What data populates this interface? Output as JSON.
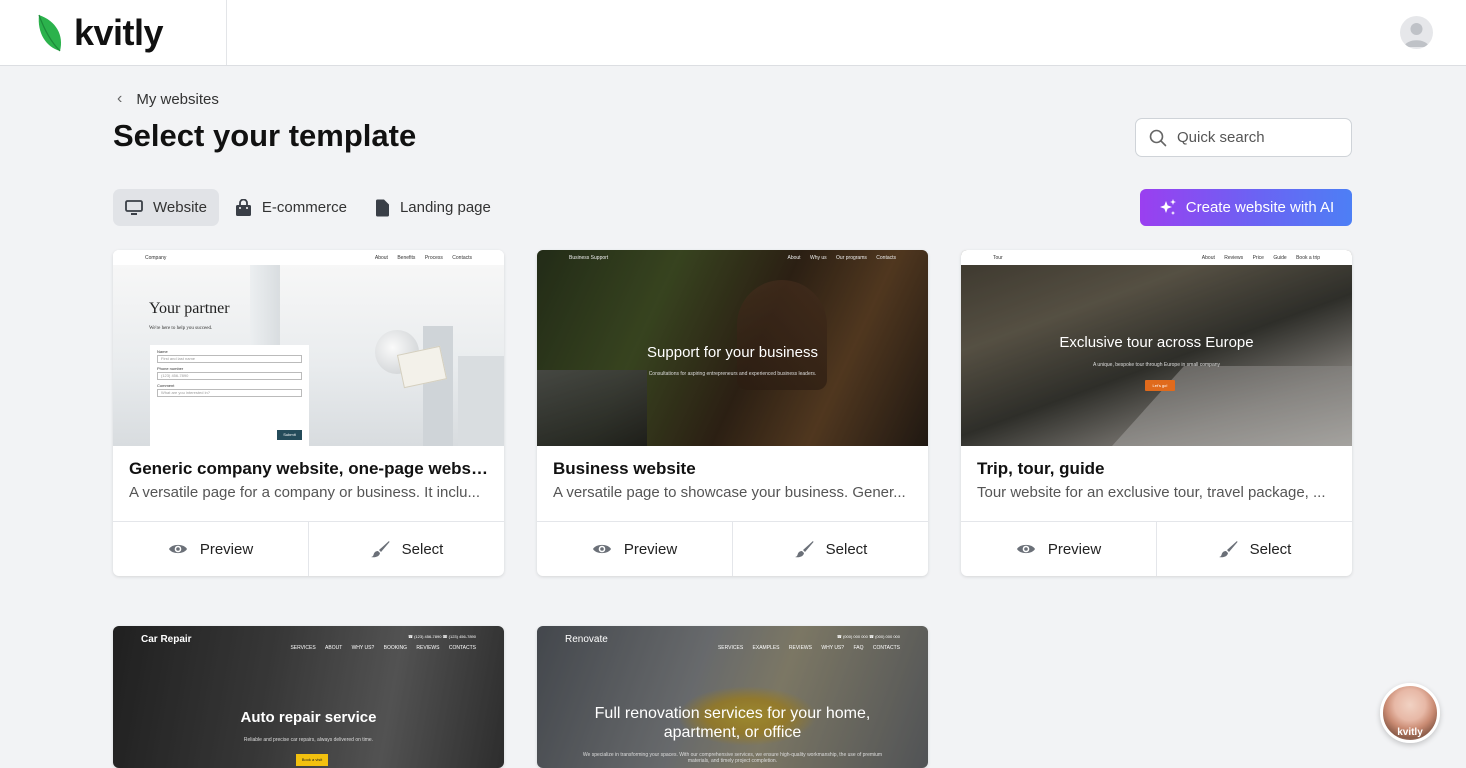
{
  "app": {
    "logo_text": "kvitly"
  },
  "breadcrumb": {
    "label": "My websites"
  },
  "page": {
    "title": "Select your template"
  },
  "search": {
    "placeholder": "Quick search"
  },
  "tabs": [
    {
      "label": "Website",
      "icon": "monitor-icon",
      "active": true
    },
    {
      "label": "E-commerce",
      "icon": "shopping-bag-icon",
      "active": false
    },
    {
      "label": "Landing page",
      "icon": "document-icon",
      "active": false
    }
  ],
  "ai_button": {
    "label": "Create website with AI",
    "icon": "sparkles-icon"
  },
  "colors": {
    "accent_gradient_start": "#9a3ff0",
    "accent_gradient_end": "#4d7ff5",
    "logo_green": "#2bb24c",
    "page_bg": "#f2f3f5"
  },
  "actions": {
    "preview": "Preview",
    "select": "Select"
  },
  "templates": [
    {
      "name": "Generic company website, one-page websit...",
      "description": "A versatile page for a company or business. It inclu...",
      "thumb": {
        "brand": "Company",
        "nav": [
          "About",
          "Benefits",
          "Process",
          "Contacts"
        ],
        "headline": "Your partner",
        "sub": "We're here to help you succeed.",
        "form": {
          "name_label": "Name",
          "name_ph": "First and last name",
          "phone_label": "Phone number",
          "phone_ph": "(123) 456-7890",
          "comment_label": "Comment",
          "comment_ph": "What are you interested in?",
          "submit": "Submit"
        }
      }
    },
    {
      "name": "Business website",
      "description": "A versatile page to showcase your business. Gener...",
      "thumb": {
        "brand": "Business Support",
        "nav": [
          "About",
          "Why us",
          "Our programs",
          "Contacts"
        ],
        "headline": "Support for your business",
        "sub": "Consultations for aspiring entrepreneurs and experienced business leaders."
      }
    },
    {
      "name": "Trip, tour, guide",
      "description": "Tour website for an exclusive tour, travel package, ...",
      "thumb": {
        "brand": "Tour",
        "nav": [
          "About",
          "Reviews",
          "Price",
          "Guide",
          "Book a trip"
        ],
        "headline": "Exclusive tour across Europe",
        "sub": "A unique, bespoke tour through Europe in small company",
        "cta": "Let's go!"
      }
    },
    {
      "name": "",
      "description": "",
      "thumb": {
        "brand": "Car Repair",
        "phones": "☎ (123) 456-7890   ☎ (123) 456-7890",
        "nav": [
          "SERVICES",
          "ABOUT",
          "WHY US?",
          "BOOKING",
          "REVIEWS",
          "CONTACTS"
        ],
        "headline": "Auto repair service",
        "sub": "Reliable and precise car repairs, always delivered on time.",
        "cta": "Book a visit"
      }
    },
    {
      "name": "",
      "description": "",
      "thumb": {
        "brand": "Renovate",
        "phones": "☎ (000) 000 000   ☎ (000) 000 000",
        "nav": [
          "SERVICES",
          "EXAMPLES",
          "REVIEWS",
          "WHY US?",
          "FAQ",
          "CONTACTS"
        ],
        "headline": "Full renovation services for your home, apartment, or office",
        "sub": "We specialize in transforming your spaces. With our comprehensive services, we ensure high-quality workmanship, the use of premium materials, and timely project completion."
      }
    }
  ]
}
